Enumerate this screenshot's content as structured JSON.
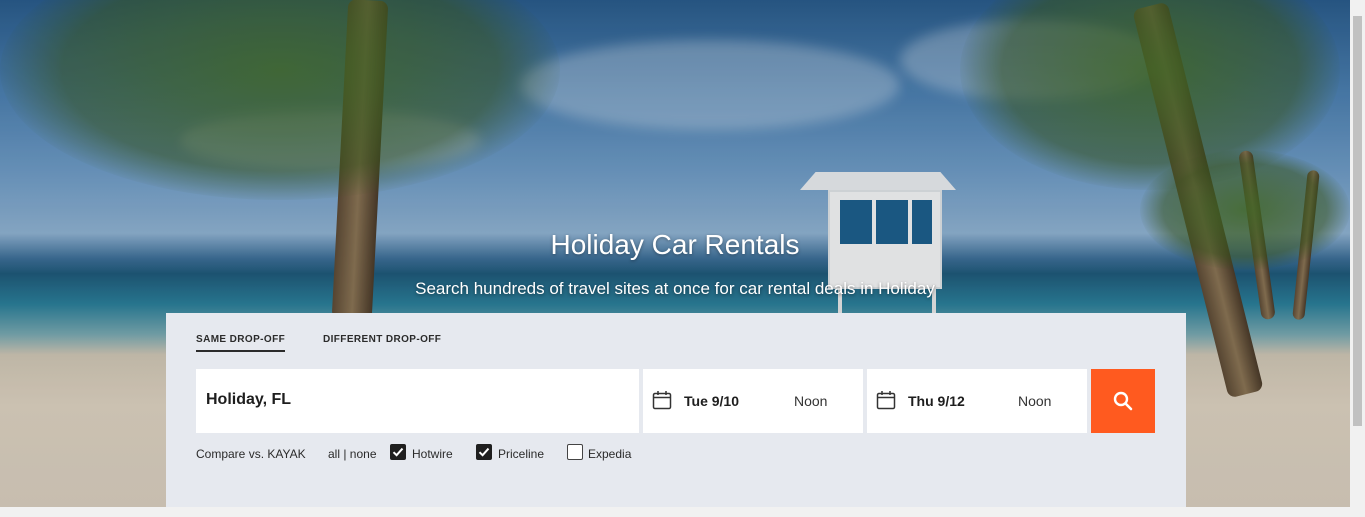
{
  "hero": {
    "title": "Holiday Car Rentals",
    "subtitle": "Search hundreds of travel sites at once for car rental deals in Holiday"
  },
  "search": {
    "tabs": [
      {
        "label": "SAME DROP-OFF",
        "active": true
      },
      {
        "label": "DIFFERENT DROP-OFF",
        "active": false
      }
    ],
    "destination": "Holiday, FL",
    "pickup": {
      "date": "Tue 9/10",
      "time": "Noon"
    },
    "dropoff": {
      "date": "Thu 9/12",
      "time": "Noon"
    },
    "search_icon": "search-icon"
  },
  "compare": {
    "label": "Compare vs. KAYAK",
    "all_none": "all | none",
    "options": [
      {
        "label": "Hotwire",
        "checked": true
      },
      {
        "label": "Priceline",
        "checked": true
      },
      {
        "label": "Expedia",
        "checked": false
      }
    ]
  },
  "colors": {
    "search_button": "#ff5a1f",
    "panel_bg": "#e6e9ef"
  }
}
